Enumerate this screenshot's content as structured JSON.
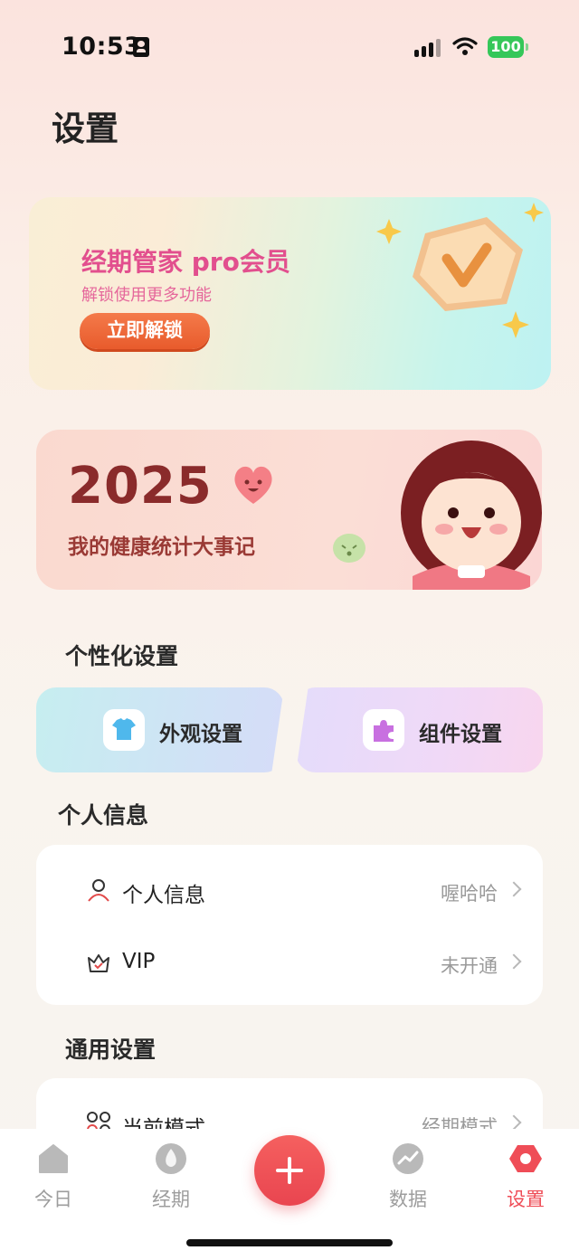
{
  "status_bar": {
    "time": "10:53",
    "battery": "100"
  },
  "page_title": "设置",
  "pro_card": {
    "title": "经期管家 pro会员",
    "subtitle": "解锁使用更多功能",
    "button": "立即解锁"
  },
  "year_card": {
    "year": "2025",
    "subtitle": "我的健康统计大事记"
  },
  "personalization": {
    "title": "个性化设置",
    "tiles": [
      {
        "label": "外观设置",
        "icon": "tshirt-icon"
      },
      {
        "label": "组件设置",
        "icon": "puzzle-icon"
      }
    ]
  },
  "personal_info": {
    "title": "个人信息",
    "rows": [
      {
        "label": "个人信息",
        "value": "喔哈哈",
        "icon": "person-icon"
      },
      {
        "label": "VIP",
        "value": "未开通",
        "icon": "crown-icon"
      }
    ]
  },
  "general": {
    "title": "通用设置",
    "rows": [
      {
        "label": "当前模式",
        "value": "经期模式",
        "icon": "grid-icon"
      }
    ]
  },
  "tab_bar": {
    "tabs": [
      {
        "label": "今日",
        "icon": "home-icon",
        "active": false
      },
      {
        "label": "经期",
        "icon": "drop-icon",
        "active": false
      },
      {
        "label": "数据",
        "icon": "chart-icon",
        "active": false
      },
      {
        "label": "设置",
        "icon": "settings-icon",
        "active": true
      }
    ],
    "add_icon": "plus-icon"
  },
  "colors": {
    "accent": "#ef4d57",
    "pro_pink": "#e24f8e",
    "unlock_orange": "#ec6434",
    "year_brown": "#8a2b2b"
  }
}
